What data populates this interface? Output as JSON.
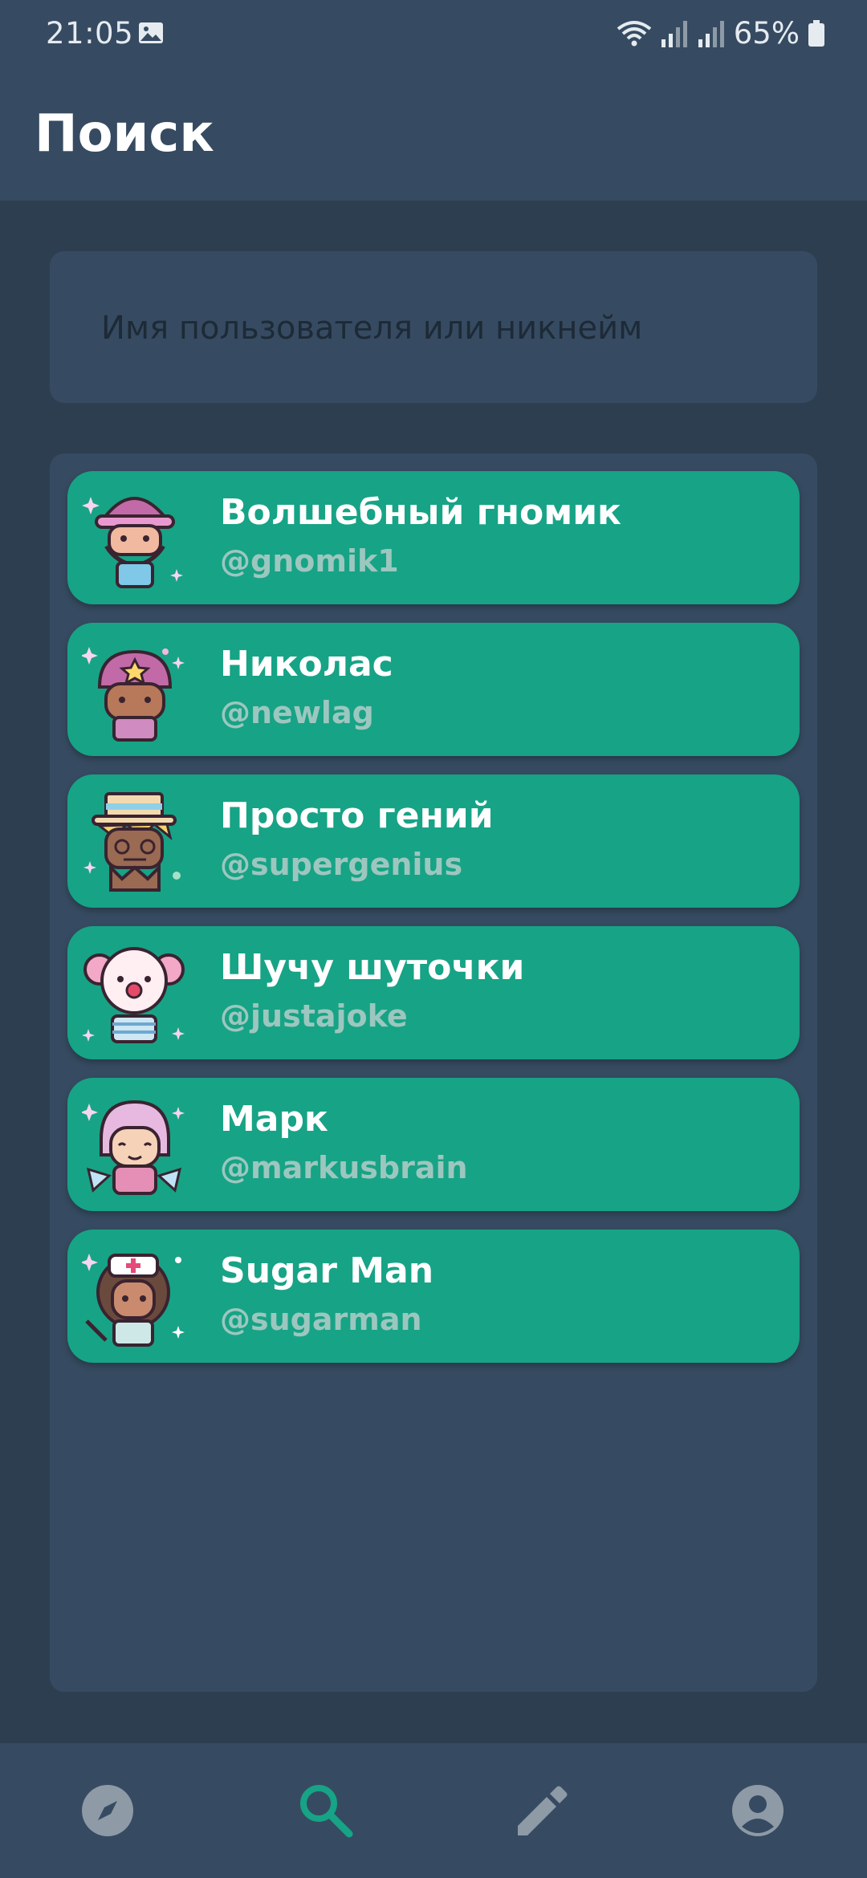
{
  "status": {
    "time": "21:05",
    "battery": "65%"
  },
  "app_bar": {
    "title": "Поиск"
  },
  "search": {
    "placeholder": "Имя пользователя или никнейм",
    "value": ""
  },
  "users": [
    {
      "name": "Волшебный гномик",
      "handle": "@gnomik1",
      "avatar_icon": "gnome-avatar-icon"
    },
    {
      "name": "Николас",
      "handle": "@newlag",
      "avatar_icon": "star-hat-avatar-icon"
    },
    {
      "name": "Просто гений",
      "handle": "@supergenius",
      "avatar_icon": "scarecrow-avatar-icon"
    },
    {
      "name": "Шучу шуточки",
      "handle": "@justajoke",
      "avatar_icon": "clown-avatar-icon"
    },
    {
      "name": "Марк",
      "handle": "@markusbrain",
      "avatar_icon": "fairy-avatar-icon"
    },
    {
      "name": "Sugar Man",
      "handle": "@sugarman",
      "avatar_icon": "nurse-avatar-icon"
    }
  ],
  "nav": {
    "items": [
      "compass-icon",
      "search-icon",
      "pencil-icon",
      "account-icon"
    ],
    "active": "search-icon"
  },
  "colors": {
    "background": "#2d3e50",
    "surface": "#364b61",
    "card": "#17a386",
    "accent": "#17a386",
    "nav_inactive": "#8e9aa6"
  }
}
